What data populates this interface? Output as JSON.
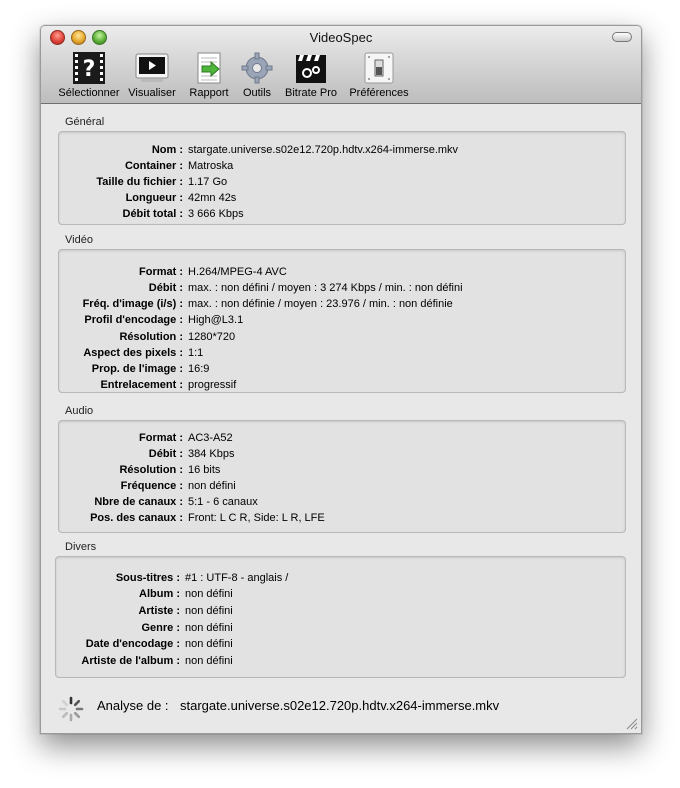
{
  "window": {
    "title": "VideoSpec"
  },
  "toolbar": {
    "items": [
      {
        "label": "Sélectionner"
      },
      {
        "label": "Visualiser"
      },
      {
        "label": "Rapport"
      },
      {
        "label": "Outils"
      },
      {
        "label": "Bitrate Pro"
      },
      {
        "label": "Préférences"
      }
    ]
  },
  "sections": {
    "general": {
      "title": "Général",
      "rows": [
        {
          "label": "Nom :",
          "value": "stargate.universe.s02e12.720p.hdtv.x264-immerse.mkv"
        },
        {
          "label": "Container :",
          "value": "Matroska"
        },
        {
          "label": "Taille du fichier :",
          "value": "1.17 Go"
        },
        {
          "label": "Longueur :",
          "value": "42mn 42s"
        },
        {
          "label": "Débit total :",
          "value": "3 666 Kbps"
        }
      ]
    },
    "video": {
      "title": "Vidéo",
      "rows": [
        {
          "label": "Format :",
          "value": "H.264/MPEG-4 AVC"
        },
        {
          "label": "Débit :",
          "value": "max. : non défini / moyen : 3 274 Kbps / min. : non défini"
        },
        {
          "label": "Fréq. d'image (i/s) :",
          "value": "max. : non définie / moyen : 23.976 / min. : non définie"
        },
        {
          "label": "Profil d'encodage :",
          "value": "High@L3.1"
        },
        {
          "label": "Résolution :",
          "value": "1280*720"
        },
        {
          "label": "Aspect des pixels :",
          "value": "1:1"
        },
        {
          "label": "Prop. de l'image :",
          "value": "16:9"
        },
        {
          "label": "Entrelacement :",
          "value": "progressif"
        }
      ]
    },
    "audio": {
      "title": "Audio",
      "rows": [
        {
          "label": "Format :",
          "value": "AC3-A52"
        },
        {
          "label": "Débit :",
          "value": "384 Kbps"
        },
        {
          "label": "Résolution :",
          "value": "16 bits"
        },
        {
          "label": "Fréquence :",
          "value": "non défini"
        },
        {
          "label": "Nbre de canaux :",
          "value": "5:1 - 6 canaux"
        },
        {
          "label": "Pos. des  canaux :",
          "value": "Front: L C R, Side: L R, LFE"
        }
      ]
    },
    "divers": {
      "title": "Divers",
      "rows": [
        {
          "label": "Sous-titres :",
          "value": "#1 : UTF-8 - anglais /"
        },
        {
          "label": "Album :",
          "value": "non défini"
        },
        {
          "label": "Artiste :",
          "value": "non défini"
        },
        {
          "label": "Genre :",
          "value": "non défini"
        },
        {
          "label": "Date d'encodage :",
          "value": "non défini"
        },
        {
          "label": "Artiste de l'album :",
          "value": "non défini"
        }
      ]
    }
  },
  "status": {
    "label": "Analyse de :",
    "file": "stargate.universe.s02e12.720p.hdtv.x264-immerse.mkv"
  }
}
